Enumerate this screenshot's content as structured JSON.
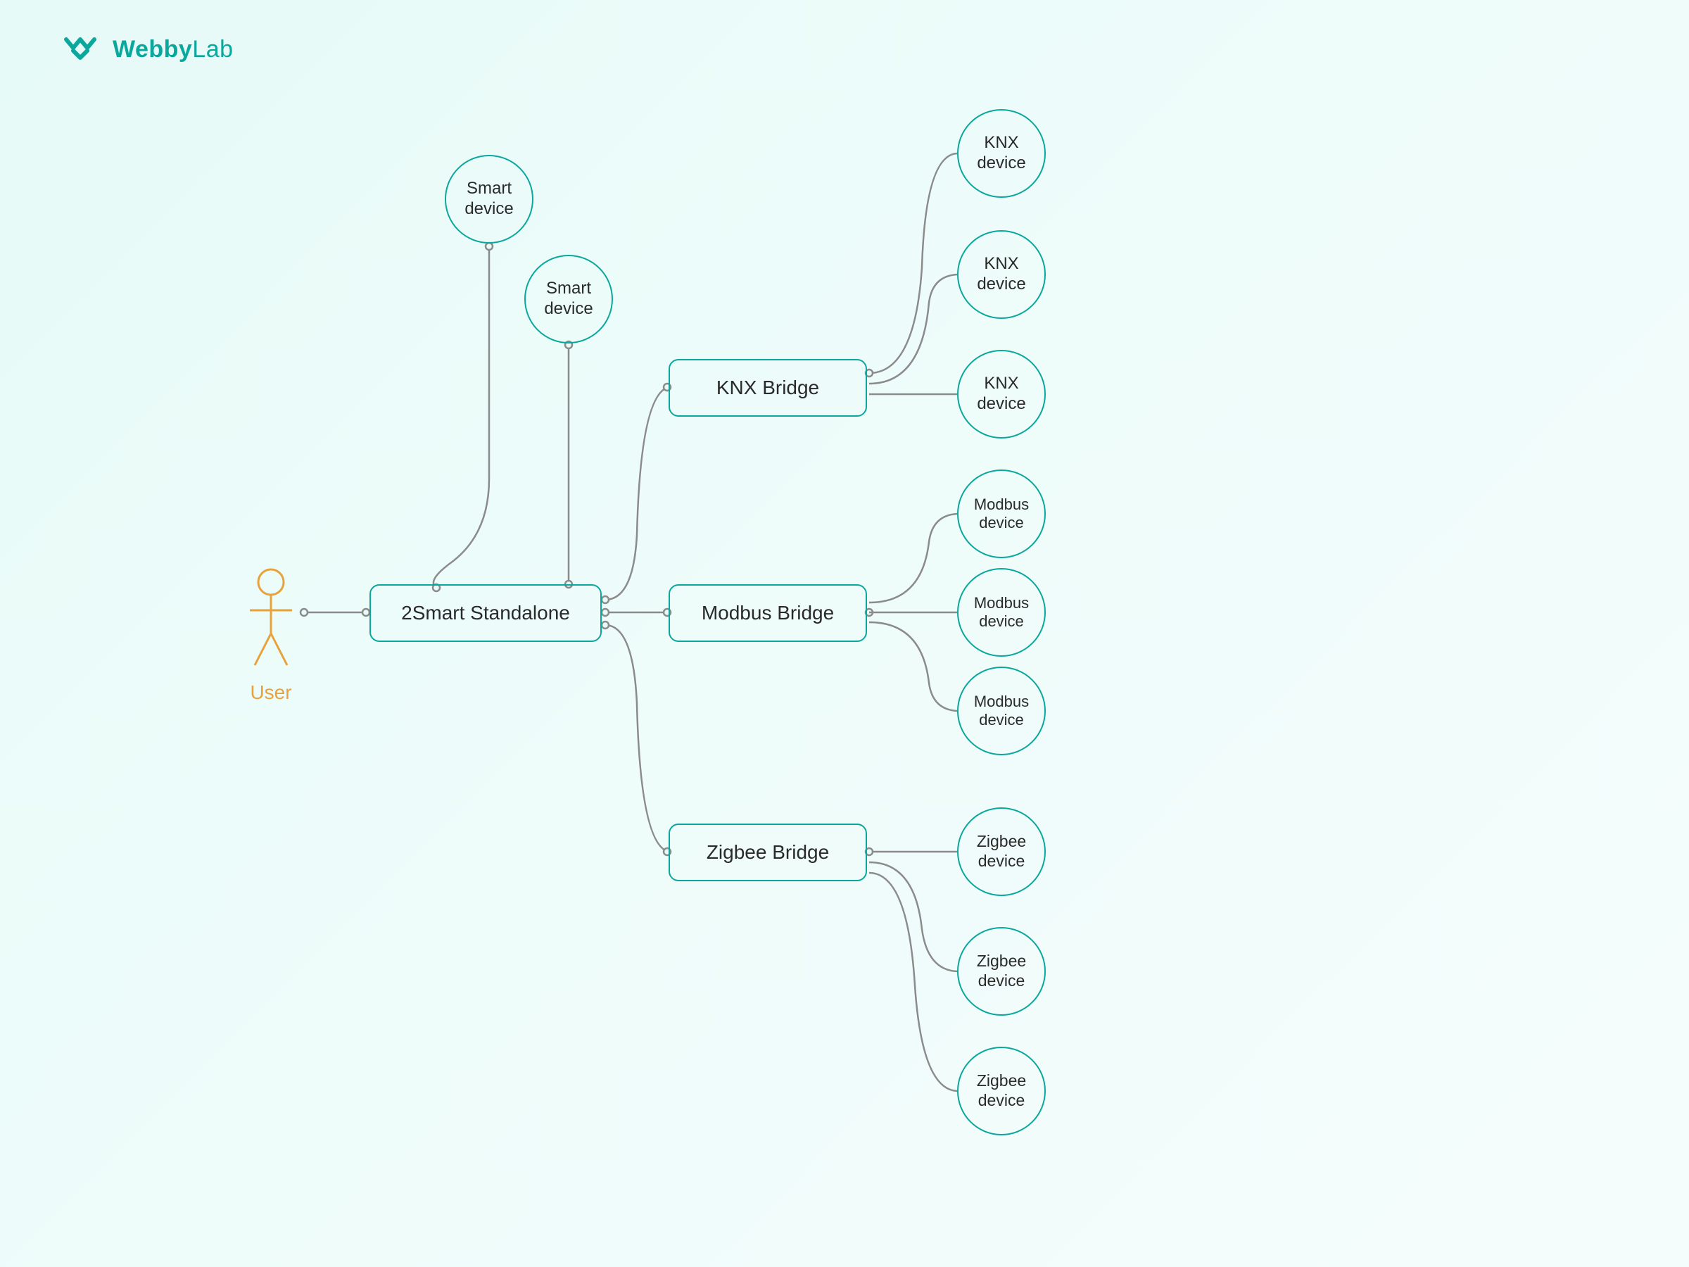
{
  "brand": {
    "name_part1": "Webby",
    "name_part2": "Lab"
  },
  "colors": {
    "accent": "#0aa79d",
    "connector": "#8b8b8b",
    "user": "#e8a23c",
    "text": "#2a2a2a"
  },
  "user": {
    "label": "User"
  },
  "main_node": {
    "label": "2Smart Standalone"
  },
  "smart_devices": [
    {
      "label": "Smart device"
    },
    {
      "label": "Smart device"
    }
  ],
  "bridges": [
    {
      "label": "KNX Bridge",
      "devices": [
        {
          "label": "KNX device"
        },
        {
          "label": "KNX device"
        },
        {
          "label": "KNX device"
        }
      ]
    },
    {
      "label": "Modbus Bridge",
      "devices": [
        {
          "label": "Modbus device"
        },
        {
          "label": "Modbus device"
        },
        {
          "label": "Modbus device"
        }
      ]
    },
    {
      "label": "Zigbee Bridge",
      "devices": [
        {
          "label": "Zigbee device"
        },
        {
          "label": "Zigbee device"
        },
        {
          "label": "Zigbee device"
        }
      ]
    }
  ]
}
